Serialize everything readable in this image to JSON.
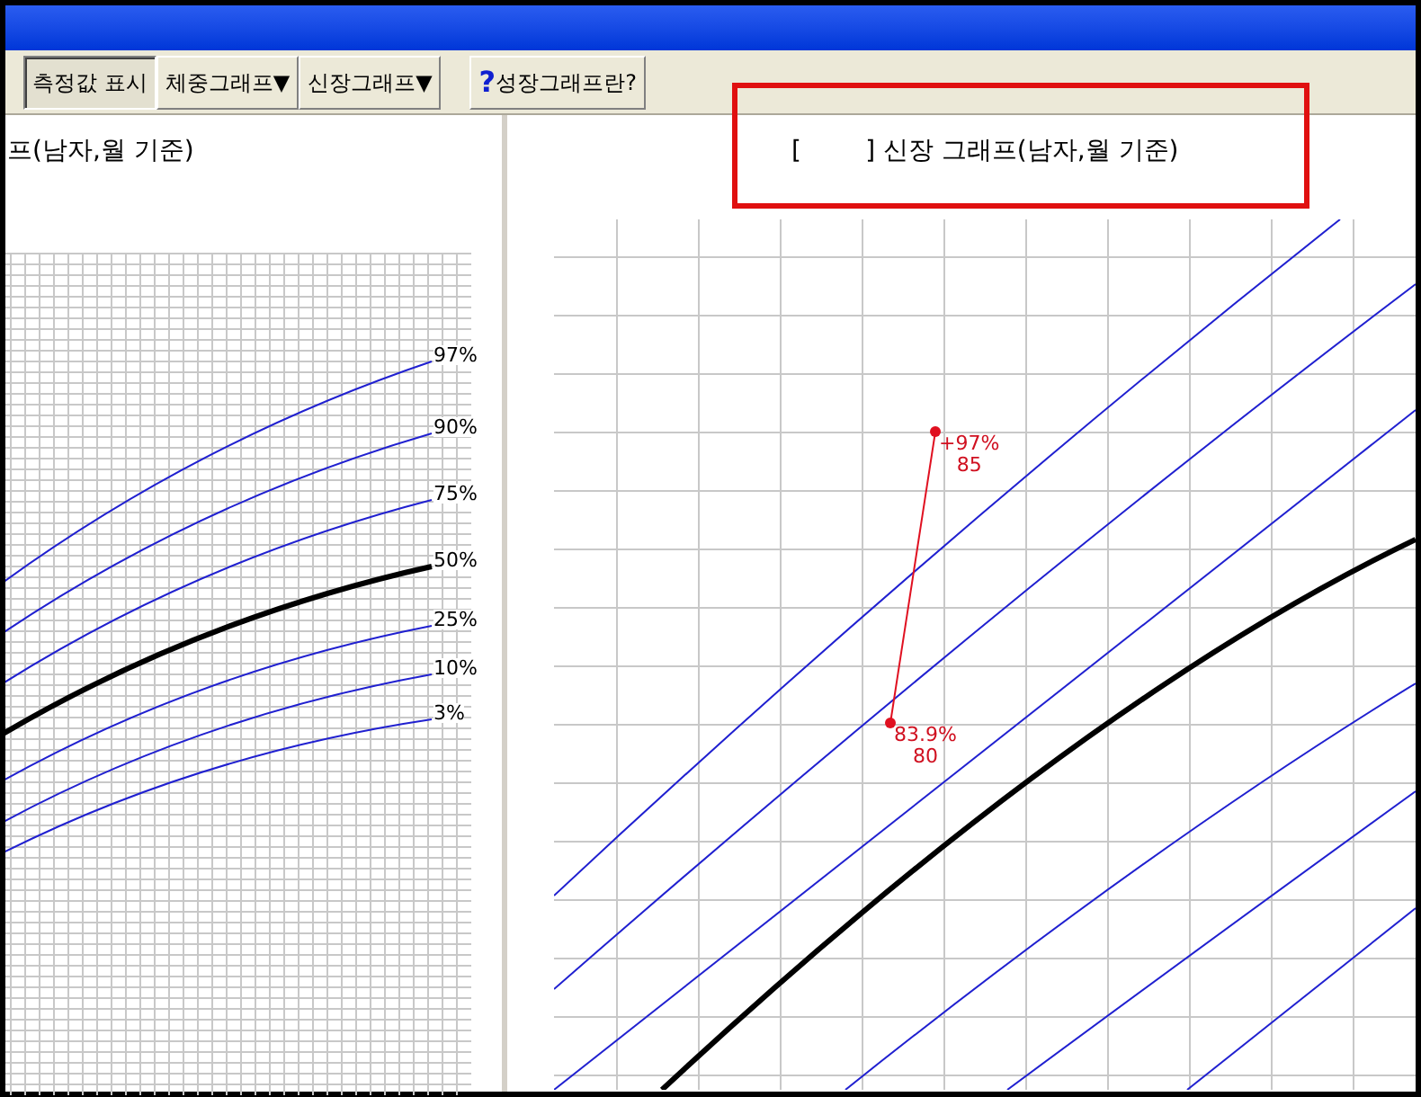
{
  "toolbar": {
    "buttons": [
      {
        "label": "측정값 표시",
        "selected": true,
        "kind": "toggle"
      },
      {
        "label": "체중그래프▼",
        "selected": false,
        "kind": "menu"
      },
      {
        "label": "신장그래프▼",
        "selected": false,
        "kind": "menu"
      },
      {
        "label": "성장그래프란?",
        "selected": false,
        "kind": "help",
        "icon": "?"
      }
    ]
  },
  "left_chart": {
    "title": "프(남자,월 기준)",
    "percentiles": [
      "97%",
      "90%",
      "75%",
      "50%",
      "25%",
      "10%",
      "3%"
    ]
  },
  "right_chart": {
    "title": "[        ] 신장 그래프(남자,월 기준)",
    "measurements": [
      {
        "percent": "+97%",
        "value": "85"
      },
      {
        "percent": "83.9%",
        "value": "80"
      }
    ]
  }
}
